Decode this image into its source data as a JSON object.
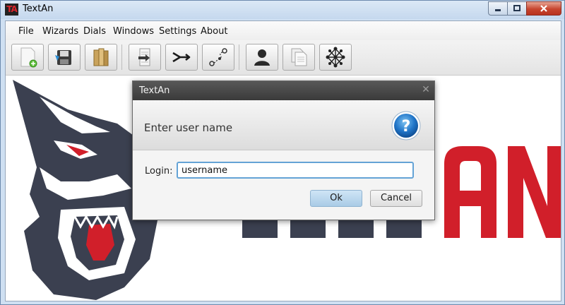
{
  "window": {
    "title": "TextAn",
    "app_icon_text": "TA"
  },
  "menubar": {
    "items": [
      "File",
      "Wizards",
      "Dials",
      "Windows",
      "Settings",
      "About"
    ]
  },
  "toolbar": {
    "buttons": [
      {
        "icon": "new-document-icon"
      },
      {
        "icon": "save-disk-icon"
      },
      {
        "icon": "open-books-icon"
      },
      {
        "icon": "import-icon"
      },
      {
        "icon": "merge-arrow-icon"
      },
      {
        "icon": "workflow-icon"
      },
      {
        "icon": "user-icon"
      },
      {
        "icon": "copy-documents-icon"
      },
      {
        "icon": "network-graph-icon"
      }
    ]
  },
  "background_logo": {
    "text_dark": "TEXT",
    "text_red": "AN",
    "red_color": "#d11f2a",
    "dark_color": "#3b4050"
  },
  "dialog": {
    "title": "TextAn",
    "header_text": "Enter user name",
    "login_label": "Login:",
    "login_value": "username",
    "ok_label": "Ok",
    "cancel_label": "Cancel"
  }
}
